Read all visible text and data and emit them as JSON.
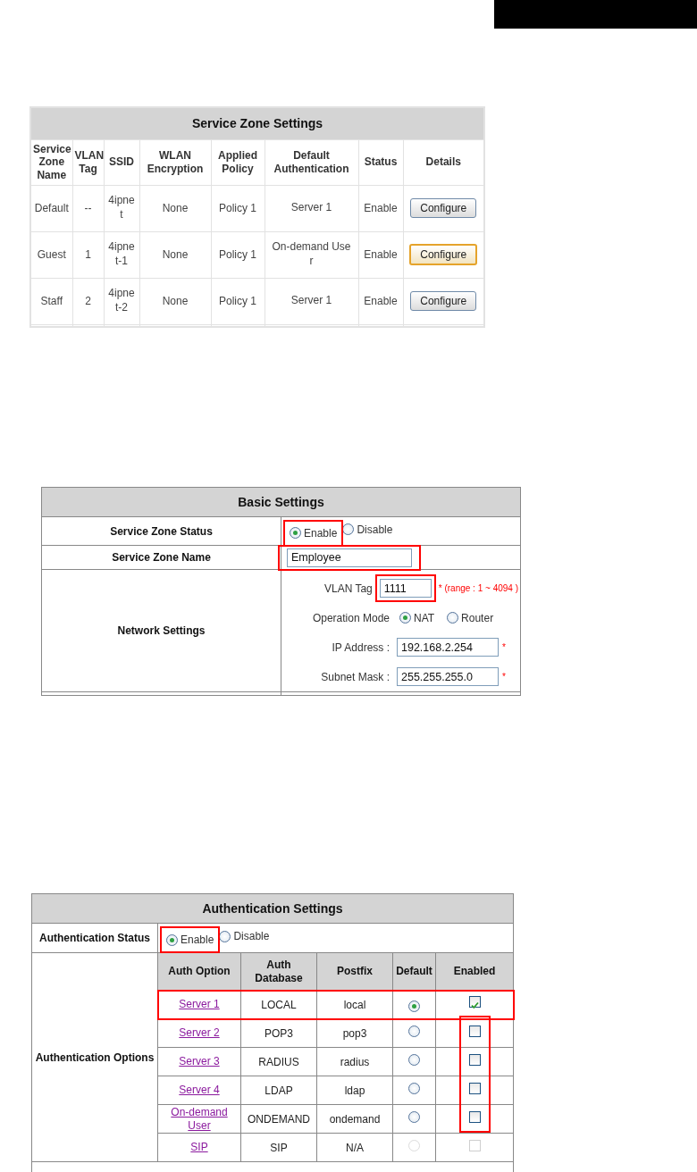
{
  "service_zones": {
    "title": "Service Zone Settings",
    "columns": [
      "Service Zone Name",
      "VLAN Tag",
      "SSID",
      "WLAN Encryption",
      "Applied Policy",
      "Default Authentication",
      "Status",
      "Details"
    ],
    "rows": [
      {
        "name": "Default",
        "vlan_tag": "--",
        "ssid": "4ipnet",
        "encryption": "None",
        "policy": "Policy 1",
        "default_auth": "Server 1",
        "status": "Enable",
        "button": "Configure",
        "focused": false
      },
      {
        "name": "Guest",
        "vlan_tag": "1",
        "ssid": "4ipnet-1",
        "encryption": "None",
        "policy": "Policy 1",
        "default_auth": "On-demand User",
        "status": "Enable",
        "button": "Configure",
        "focused": true
      },
      {
        "name": "Staff",
        "vlan_tag": "2",
        "ssid": "4ipnet-2",
        "encryption": "None",
        "policy": "Policy 1",
        "default_auth": "Server 1",
        "status": "Enable",
        "button": "Configure",
        "focused": false
      }
    ]
  },
  "basic_settings": {
    "title": "Basic Settings",
    "status": {
      "label": "Service Zone Status",
      "options": [
        {
          "label": "Enable",
          "selected": true,
          "highlighted": true
        },
        {
          "label": "Disable",
          "selected": false,
          "highlighted": false
        }
      ]
    },
    "name": {
      "label": "Service Zone Name",
      "value": "Employee",
      "highlighted": true
    },
    "network": {
      "label": "Network Settings",
      "vlan_tag": {
        "label": "VLAN Tag",
        "value": "1111",
        "highlighted": true,
        "note": "* (range : 1 ~ 4094 )"
      },
      "operation_mode": {
        "label": "Operation Mode",
        "options": [
          {
            "label": "NAT",
            "selected": true
          },
          {
            "label": "Router",
            "selected": false
          }
        ]
      },
      "ip_address": {
        "label": "IP Address :",
        "value": "192.168.2.254",
        "required_mark": "*"
      },
      "subnet_mask": {
        "label": "Subnet Mask :",
        "value": "255.255.255.0",
        "required_mark": "*"
      }
    }
  },
  "auth_settings": {
    "title": "Authentication Settings",
    "status": {
      "label": "Authentication Status",
      "options": [
        {
          "label": "Enable",
          "selected": true,
          "highlighted": true
        },
        {
          "label": "Disable",
          "selected": false,
          "highlighted": false
        }
      ]
    },
    "options_label": "Authentication Options",
    "columns": [
      "Auth Option",
      "Auth Database",
      "Postfix",
      "Default",
      "Enabled"
    ],
    "rows": [
      {
        "option": "Server 1",
        "database": "LOCAL",
        "postfix": "local",
        "default_selected": true,
        "disabled": false,
        "enabled_checked": true,
        "row_highlighted": true,
        "enabled_highlighted": false
      },
      {
        "option": "Server 2",
        "database": "POP3",
        "postfix": "pop3",
        "default_selected": false,
        "disabled": false,
        "enabled_checked": false,
        "row_highlighted": false,
        "enabled_highlighted": true
      },
      {
        "option": "Server 3",
        "database": "RADIUS",
        "postfix": "radius",
        "default_selected": false,
        "disabled": false,
        "enabled_checked": false,
        "row_highlighted": false,
        "enabled_highlighted": true
      },
      {
        "option": "Server 4",
        "database": "LDAP",
        "postfix": "ldap",
        "default_selected": false,
        "disabled": false,
        "enabled_checked": false,
        "row_highlighted": false,
        "enabled_highlighted": true
      },
      {
        "option": "On-demand User",
        "database": "ONDEMAND",
        "postfix": "ondemand",
        "default_selected": false,
        "disabled": false,
        "enabled_checked": false,
        "row_highlighted": false,
        "enabled_highlighted": true
      },
      {
        "option": "SIP",
        "database": "SIP",
        "postfix": "N/A",
        "default_selected": false,
        "disabled": true,
        "enabled_checked": false,
        "row_highlighted": false,
        "enabled_highlighted": false
      }
    ]
  }
}
